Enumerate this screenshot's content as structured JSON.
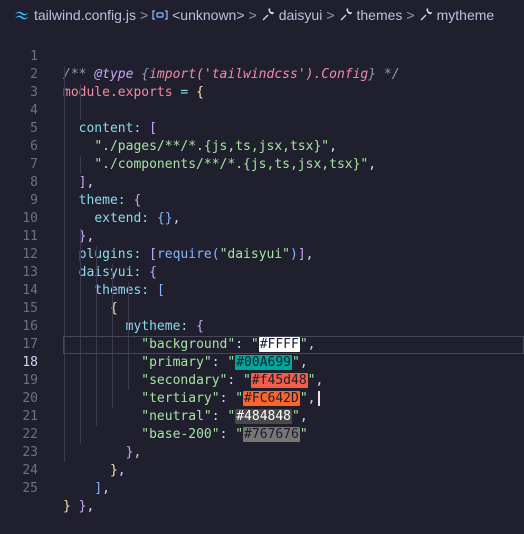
{
  "breadcrumb": {
    "file": "tailwind.config.js",
    "items": [
      "<unknown>",
      "daisyui",
      "themes",
      "mytheme"
    ],
    "separator": ">"
  },
  "editor": {
    "line_numbers": [
      "1",
      "2",
      "3",
      "4",
      "5",
      "6",
      "7",
      "8",
      "9",
      "10",
      "11",
      "12",
      "13",
      "14",
      "15",
      "16",
      "17",
      "18",
      "19",
      "20",
      "21",
      "22",
      "23",
      "24",
      "25"
    ],
    "active_line": "18",
    "code": {
      "l1_a": "/** ",
      "l1_b": "@type",
      "l1_c": " {",
      "l1_d": "import('tailwindcss').Config",
      "l1_e": "} */",
      "l2_a": "module",
      "l2_b": ".exports",
      "l2_c": " = ",
      "l2_d": "{",
      "l3_a": "content",
      "l3_b": ": ",
      "l3_c": "[",
      "l4": "\"./pages/**/*.{js,ts,jsx,tsx}\"",
      "l4_c": ",",
      "l5": "\"./components/**/*.{js,ts,jsx,tsx}\"",
      "l5_c": ",",
      "l6_a": "]",
      "l6_b": ",",
      "l7_a": "theme",
      "l7_b": ": ",
      "l7_c": "{",
      "l8_a": "extend",
      "l8_b": ": ",
      "l8_c": "{}",
      "l8_d": ",",
      "l9_a": "}",
      "l9_b": ",",
      "l10_a": "plugins",
      "l10_b": ": ",
      "l10_c": "[",
      "l10_d": "require",
      "l10_e": "(",
      "l10_f": "\"daisyui\"",
      "l10_g": ")",
      "l10_h": "]",
      "l10_i": ",",
      "l11_a": "daisyui",
      "l11_b": ": ",
      "l11_c": "{",
      "l12_a": "themes",
      "l12_b": ": ",
      "l12_c": "[",
      "l13": "{",
      "l14_a": "mytheme",
      "l14_b": ": ",
      "l14_c": "{",
      "colors": [
        {
          "key": "\"background\"",
          "q": "\"",
          "value": "#FFFF",
          "bg": "#ffffff",
          "fg": "#1e1e2e"
        },
        {
          "key": "\"primary\"",
          "q": "\"",
          "value": "#00A699",
          "bg": "#00a699",
          "fg": "#1e1e2e"
        },
        {
          "key": "\"secondary\"",
          "q": "\"",
          "value": "#f45d48",
          "bg": "#f45d48",
          "fg": "#1e1e2e"
        },
        {
          "key": "\"tertiary\"",
          "q": "\"",
          "value": "#FC642D",
          "bg": "#fc642d",
          "fg": "#1e1e2e"
        },
        {
          "key": "\"neutral\"",
          "q": "\"",
          "value": "#484848",
          "bg": "#484848",
          "fg": "#ffffff"
        },
        {
          "key": "\"base-200\"",
          "q": "\"",
          "value": "#767676",
          "bg": "#767676",
          "fg": "#1e1e2e"
        }
      ],
      "l21_a": "}",
      "l21_b": ",",
      "l22_a": "}",
      "l22_b": ",",
      "l23_a": "]",
      "l23_b": ",",
      "l24_a": "}",
      "l24_b": ",",
      "l25": "}"
    }
  }
}
